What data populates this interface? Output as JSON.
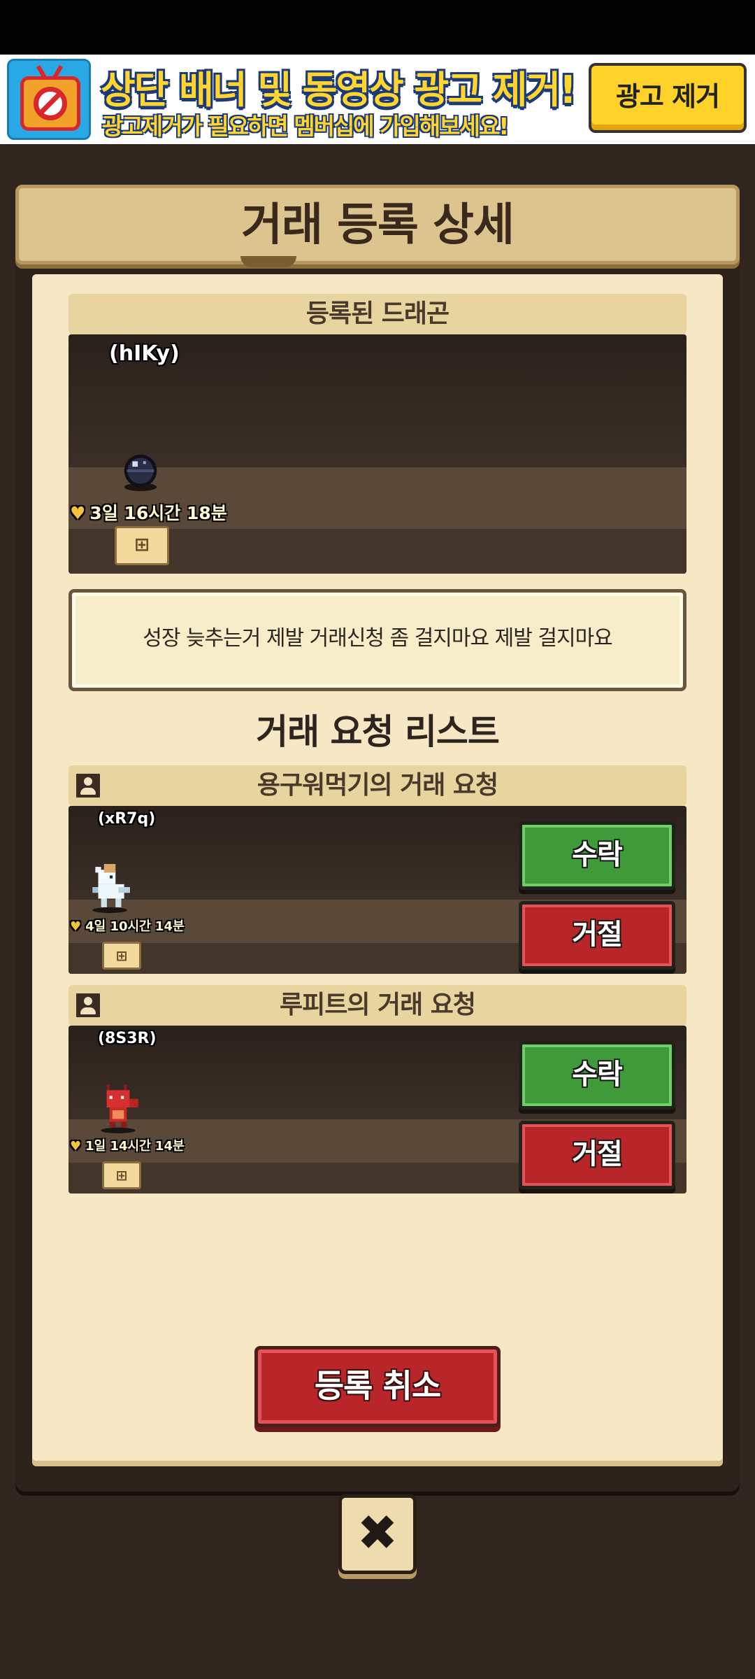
{
  "ad": {
    "title": "상단 배너 및 동영상 광고 제거!",
    "subtitle": "광고제거가 필요하면 멤버십에 가입해보세요!",
    "remove_button": "광고 제거",
    "icon": "no-ads-tv-icon"
  },
  "panel": {
    "title": "거래 등록 상세"
  },
  "registered": {
    "header": "등록된 드래곤",
    "dragon_code": "(hIKy)",
    "timer": "3일 16시간 18분",
    "note": "성장 늦추는거 제발 거래신청 좀 걸지마요 제발 걸지마요"
  },
  "requests": {
    "title": "거래 요청 리스트",
    "items": [
      {
        "header": "용구워먹기의 거래 요청",
        "dragon_code": "(xR7q)",
        "timer": "4일 10시간 14분",
        "accept_label": "수락",
        "reject_label": "거절"
      },
      {
        "header": "루피트의 거래 요청",
        "dragon_code": "(8S3R)",
        "timer": "1일 14시간 14분",
        "accept_label": "수락",
        "reject_label": "거절"
      }
    ]
  },
  "actions": {
    "cancel_registration": "등록 취소",
    "close_symbol": "✖"
  },
  "icons": {
    "heart": "♥",
    "tree": "family-tree-icon",
    "profile": "profile-icon",
    "close": "close-icon"
  },
  "colors": {
    "accept": "#3f9a3a",
    "reject": "#b8262a",
    "paper": "#f6e8c4",
    "ad_accent": "#ffd22a"
  }
}
